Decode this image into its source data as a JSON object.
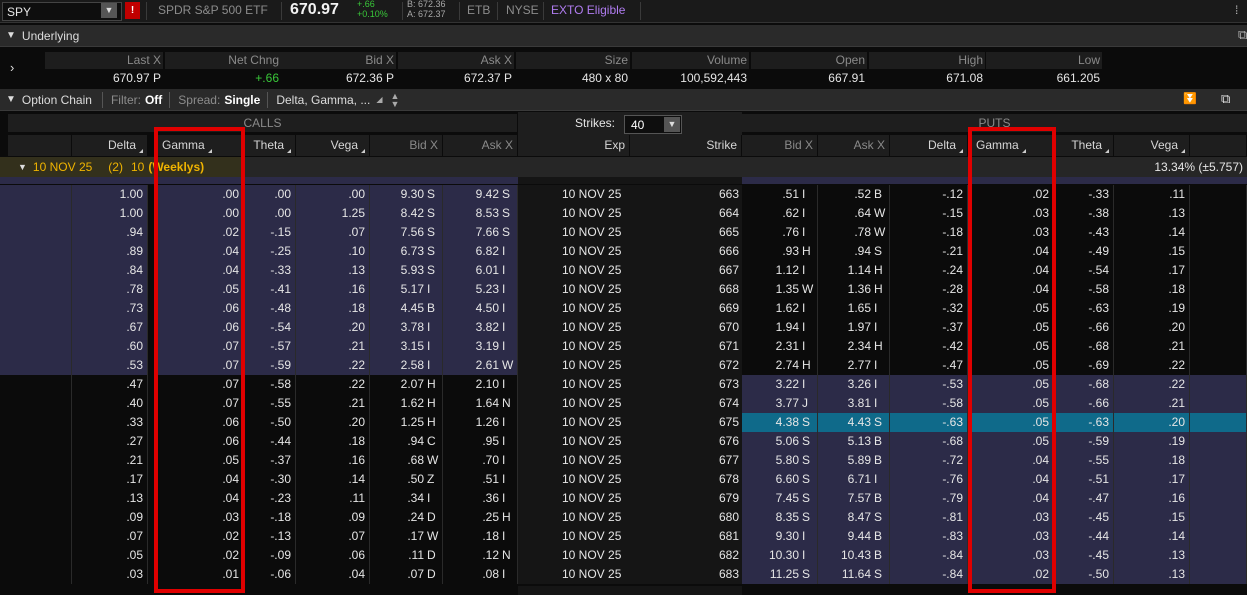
{
  "header": {
    "symbol": "SPY",
    "description": "SPDR S&P 500 ETF",
    "last": "670.97",
    "change_abs": "+.66",
    "change_pct": "+0.10%",
    "bid": "B: 672.36",
    "ask": "A: 672.37",
    "tags": [
      "ETB",
      "NYSE"
    ],
    "exto": "EXTO Eligible"
  },
  "underlying": {
    "title": "Underlying",
    "columns": [
      "Last X",
      "Net Chng",
      "Bid X",
      "Ask X",
      "Size",
      "Volume",
      "Open",
      "High",
      "Low"
    ],
    "values": [
      "670.97 P",
      "+.66",
      "672.36 P",
      "672.37 P",
      "480 x 80",
      "100,592,443",
      "667.91",
      "671.08",
      "661.205"
    ]
  },
  "option_chain": {
    "title": "Option Chain",
    "filter_label": "Filter:",
    "filter_value": "Off",
    "spread_label": "Spread:",
    "spread_value": "Single",
    "layout": "Delta, Gamma, ...",
    "strikes_label": "Strikes:",
    "strikes_value": "40",
    "calls_label": "CALLS",
    "puts_label": "PUTS",
    "call_columns": [
      "Delta",
      "Gamma",
      "Theta",
      "Vega",
      "Bid X",
      "Ask X"
    ],
    "middle_columns": [
      "Exp",
      "Strike"
    ],
    "put_columns": [
      "Bid X",
      "Ask X",
      "Delta",
      "Gamma",
      "Theta",
      "Vega"
    ],
    "expiry_row": {
      "date": "10 NOV 25",
      "count": "(2)",
      "num": "10",
      "weeklys": "(Weeklys)",
      "iv": "13.34% (±5.757)"
    },
    "rows": [
      {
        "cd": "1.00",
        "cg": ".00",
        "ct": ".00",
        "cv": ".00",
        "cb": "9.30",
        "cbx": "S",
        "ca": "9.42",
        "cax": "S",
        "exp": "10 NOV 25",
        "k": "663",
        "pb": ".51",
        "pbx": "I",
        "pa": ".52",
        "pax": "B",
        "pd": "-.12",
        "pg": ".02",
        "pt": "-.33",
        "pv": ".11"
      },
      {
        "cd": "1.00",
        "cg": ".00",
        "ct": ".00",
        "cv": "1.25",
        "cb": "8.42",
        "cbx": "S",
        "ca": "8.53",
        "cax": "S",
        "exp": "10 NOV 25",
        "k": "664",
        "pb": ".62",
        "pbx": "I",
        "pa": ".64",
        "pax": "W",
        "pd": "-.15",
        "pg": ".03",
        "pt": "-.38",
        "pv": ".13"
      },
      {
        "cd": ".94",
        "cg": ".02",
        "ct": "-.15",
        "cv": ".07",
        "cb": "7.56",
        "cbx": "S",
        "ca": "7.66",
        "cax": "S",
        "exp": "10 NOV 25",
        "k": "665",
        "pb": ".76",
        "pbx": "I",
        "pa": ".78",
        "pax": "W",
        "pd": "-.18",
        "pg": ".03",
        "pt": "-.43",
        "pv": ".14"
      },
      {
        "cd": ".89",
        "cg": ".04",
        "ct": "-.25",
        "cv": ".10",
        "cb": "6.73",
        "cbx": "S",
        "ca": "6.82",
        "cax": "I",
        "exp": "10 NOV 25",
        "k": "666",
        "pb": ".93",
        "pbx": "H",
        "pa": ".94",
        "pax": "S",
        "pd": "-.21",
        "pg": ".04",
        "pt": "-.49",
        "pv": ".15"
      },
      {
        "cd": ".84",
        "cg": ".04",
        "ct": "-.33",
        "cv": ".13",
        "cb": "5.93",
        "cbx": "S",
        "ca": "6.01",
        "cax": "I",
        "exp": "10 NOV 25",
        "k": "667",
        "pb": "1.12",
        "pbx": "I",
        "pa": "1.14",
        "pax": "H",
        "pd": "-.24",
        "pg": ".04",
        "pt": "-.54",
        "pv": ".17"
      },
      {
        "cd": ".78",
        "cg": ".05",
        "ct": "-.41",
        "cv": ".16",
        "cb": "5.17",
        "cbx": "I",
        "ca": "5.23",
        "cax": "I",
        "exp": "10 NOV 25",
        "k": "668",
        "pb": "1.35",
        "pbx": "W",
        "pa": "1.36",
        "pax": "H",
        "pd": "-.28",
        "pg": ".04",
        "pt": "-.58",
        "pv": ".18"
      },
      {
        "cd": ".73",
        "cg": ".06",
        "ct": "-.48",
        "cv": ".18",
        "cb": "4.45",
        "cbx": "B",
        "ca": "4.50",
        "cax": "I",
        "exp": "10 NOV 25",
        "k": "669",
        "pb": "1.62",
        "pbx": "I",
        "pa": "1.65",
        "pax": "I",
        "pd": "-.32",
        "pg": ".05",
        "pt": "-.63",
        "pv": ".19"
      },
      {
        "cd": ".67",
        "cg": ".06",
        "ct": "-.54",
        "cv": ".20",
        "cb": "3.78",
        "cbx": "I",
        "ca": "3.82",
        "cax": "I",
        "exp": "10 NOV 25",
        "k": "670",
        "pb": "1.94",
        "pbx": "I",
        "pa": "1.97",
        "pax": "I",
        "pd": "-.37",
        "pg": ".05",
        "pt": "-.66",
        "pv": ".20"
      },
      {
        "cd": ".60",
        "cg": ".07",
        "ct": "-.57",
        "cv": ".21",
        "cb": "3.15",
        "cbx": "I",
        "ca": "3.19",
        "cax": "I",
        "exp": "10 NOV 25",
        "k": "671",
        "pb": "2.31",
        "pbx": "I",
        "pa": "2.34",
        "pax": "H",
        "pd": "-.42",
        "pg": ".05",
        "pt": "-.68",
        "pv": ".21"
      },
      {
        "cd": ".53",
        "cg": ".07",
        "ct": "-.59",
        "cv": ".22",
        "cb": "2.58",
        "cbx": "I",
        "ca": "2.61",
        "cax": "W",
        "exp": "10 NOV 25",
        "k": "672",
        "pb": "2.74",
        "pbx": "H",
        "pa": "2.77",
        "pax": "I",
        "pd": "-.47",
        "pg": ".05",
        "pt": "-.69",
        "pv": ".22"
      },
      {
        "cd": ".47",
        "cg": ".07",
        "ct": "-.58",
        "cv": ".22",
        "cb": "2.07",
        "cbx": "H",
        "ca": "2.10",
        "cax": "I",
        "exp": "10 NOV 25",
        "k": "673",
        "pb": "3.22",
        "pbx": "I",
        "pa": "3.26",
        "pax": "I",
        "pd": "-.53",
        "pg": ".05",
        "pt": "-.68",
        "pv": ".22"
      },
      {
        "cd": ".40",
        "cg": ".07",
        "ct": "-.55",
        "cv": ".21",
        "cb": "1.62",
        "cbx": "H",
        "ca": "1.64",
        "cax": "N",
        "exp": "10 NOV 25",
        "k": "674",
        "pb": "3.77",
        "pbx": "J",
        "pa": "3.81",
        "pax": "I",
        "pd": "-.58",
        "pg": ".05",
        "pt": "-.66",
        "pv": ".21"
      },
      {
        "cd": ".33",
        "cg": ".06",
        "ct": "-.50",
        "cv": ".20",
        "cb": "1.25",
        "cbx": "H",
        "ca": "1.26",
        "cax": "I",
        "exp": "10 NOV 25",
        "k": "675",
        "pb": "4.38",
        "pbx": "S",
        "pa": "4.43",
        "pax": "S",
        "pd": "-.63",
        "pg": ".05",
        "pt": "-.63",
        "pv": ".20"
      },
      {
        "cd": ".27",
        "cg": ".06",
        "ct": "-.44",
        "cv": ".18",
        "cb": ".94",
        "cbx": "C",
        "ca": ".95",
        "cax": "I",
        "exp": "10 NOV 25",
        "k": "676",
        "pb": "5.06",
        "pbx": "S",
        "pa": "5.13",
        "pax": "B",
        "pd": "-.68",
        "pg": ".05",
        "pt": "-.59",
        "pv": ".19"
      },
      {
        "cd": ".21",
        "cg": ".05",
        "ct": "-.37",
        "cv": ".16",
        "cb": ".68",
        "cbx": "W",
        "ca": ".70",
        "cax": "I",
        "exp": "10 NOV 25",
        "k": "677",
        "pb": "5.80",
        "pbx": "S",
        "pa": "5.89",
        "pax": "B",
        "pd": "-.72",
        "pg": ".04",
        "pt": "-.55",
        "pv": ".18"
      },
      {
        "cd": ".17",
        "cg": ".04",
        "ct": "-.30",
        "cv": ".14",
        "cb": ".50",
        "cbx": "Z",
        "ca": ".51",
        "cax": "I",
        "exp": "10 NOV 25",
        "k": "678",
        "pb": "6.60",
        "pbx": "S",
        "pa": "6.71",
        "pax": "I",
        "pd": "-.76",
        "pg": ".04",
        "pt": "-.51",
        "pv": ".17"
      },
      {
        "cd": ".13",
        "cg": ".04",
        "ct": "-.23",
        "cv": ".11",
        "cb": ".34",
        "cbx": "I",
        "ca": ".36",
        "cax": "I",
        "exp": "10 NOV 25",
        "k": "679",
        "pb": "7.45",
        "pbx": "S",
        "pa": "7.57",
        "pax": "B",
        "pd": "-.79",
        "pg": ".04",
        "pt": "-.47",
        "pv": ".16"
      },
      {
        "cd": ".09",
        "cg": ".03",
        "ct": "-.18",
        "cv": ".09",
        "cb": ".24",
        "cbx": "D",
        "ca": ".25",
        "cax": "H",
        "exp": "10 NOV 25",
        "k": "680",
        "pb": "8.35",
        "pbx": "S",
        "pa": "8.47",
        "pax": "S",
        "pd": "-.81",
        "pg": ".03",
        "pt": "-.45",
        "pv": ".15"
      },
      {
        "cd": ".07",
        "cg": ".02",
        "ct": "-.13",
        "cv": ".07",
        "cb": ".17",
        "cbx": "W",
        "ca": ".18",
        "cax": "I",
        "exp": "10 NOV 25",
        "k": "681",
        "pb": "9.30",
        "pbx": "I",
        "pa": "9.44",
        "pax": "B",
        "pd": "-.83",
        "pg": ".03",
        "pt": "-.44",
        "pv": ".14"
      },
      {
        "cd": ".05",
        "cg": ".02",
        "ct": "-.09",
        "cv": ".06",
        "cb": ".11",
        "cbx": "D",
        "ca": ".12",
        "cax": "N",
        "exp": "10 NOV 25",
        "k": "682",
        "pb": "10.30",
        "pbx": "I",
        "pa": "10.43",
        "pax": "B",
        "pd": "-.84",
        "pg": ".03",
        "pt": "-.45",
        "pv": ".13"
      },
      {
        "cd": ".03",
        "cg": ".01",
        "ct": "-.06",
        "cv": ".04",
        "cb": ".07",
        "cbx": "D",
        "ca": ".08",
        "cax": "I",
        "exp": "10 NOV 25",
        "k": "683",
        "pb": "11.25",
        "pbx": "S",
        "pa": "11.64",
        "pax": "S",
        "pd": "-.84",
        "pg": ".02",
        "pt": "-.50",
        "pv": ".13"
      }
    ]
  },
  "colors": {
    "itm_bg": "#2c2b48",
    "otm_bg": "#0b0b0b",
    "atm_bg": "#0f6a8a",
    "highlight_box": "#e00000",
    "positive": "#39c739",
    "weeklys": "#f0b400"
  }
}
